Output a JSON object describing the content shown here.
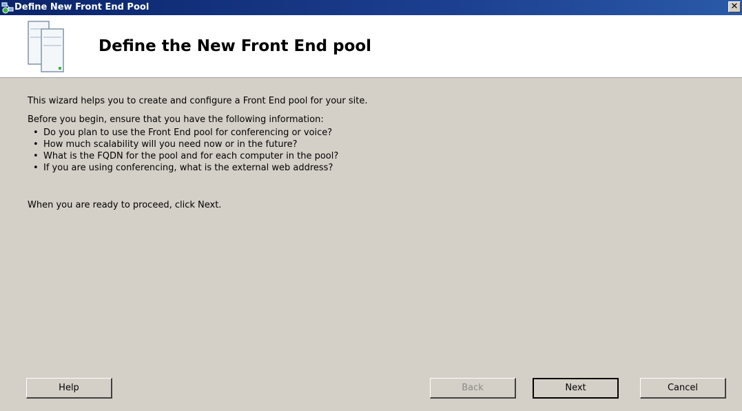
{
  "window": {
    "title": "Define New Front End Pool"
  },
  "header": {
    "title": "Define the New Front End pool"
  },
  "content": {
    "intro": "This wizard helps you to create and configure a Front End pool for your site.",
    "before_you_begin": "Before you begin, ensure that you have the following information:",
    "bullets": [
      "Do you plan to use the Front End pool for conferencing or voice?",
      "How much scalability will you need now or in the future?",
      "What is the FQDN for the pool and for each computer in the pool?",
      "If you are using conferencing, what is the external web address?"
    ],
    "ready": "When you are ready to proceed, click Next."
  },
  "buttons": {
    "help": "Help",
    "back": "Back",
    "next": "Next",
    "cancel": "Cancel",
    "close_glyph": "✕"
  },
  "icons": {
    "app": "topology-builder-icon",
    "header": "server-pool-icon",
    "close": "close-icon"
  }
}
